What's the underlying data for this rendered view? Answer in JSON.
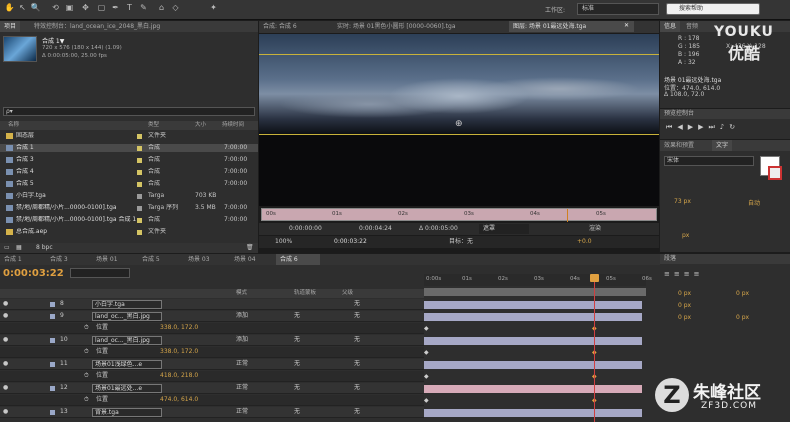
{
  "toolbar": {
    "workspace_label": "工作区:",
    "workspace_value": "标准",
    "search_placeholder": "搜索帮助"
  },
  "watermark": {
    "youku": "YOUKU",
    "youku_cn": "优酷",
    "zf_name": "朱峰社区",
    "zf_url": "ZF3D.COM"
  },
  "project": {
    "tab": "项目",
    "tab2": "特效控制台：land_ocean_ice_2048_黑白.jpg",
    "item_name": "合成 1▼",
    "item_size": "720 x 576 (180 x 144) (1.09)",
    "item_dur": "Δ 0:00:05:00, 25.00 fps",
    "search_placeholder": "ρ▾",
    "col_name": "名称",
    "col_type": "类型",
    "col_size": "大小",
    "col_rate": "持续时间",
    "items": [
      {
        "name": "固态层",
        "type": "文件夹",
        "size": "",
        "dur": "",
        "color": "#d4c464"
      },
      {
        "name": "合成 1",
        "type": "合成",
        "size": "",
        "dur": "7:00:00",
        "color": "#d4c464"
      },
      {
        "name": "合成 3",
        "type": "合成",
        "size": "",
        "dur": "7:00:00",
        "color": "#d4c464"
      },
      {
        "name": "合成 4",
        "type": "合成",
        "size": "",
        "dur": "7:00:00",
        "color": "#d4c464"
      },
      {
        "name": "合成 5",
        "type": "合成",
        "size": "",
        "dur": "7:00:00",
        "color": "#d4c464"
      },
      {
        "name": "小白字.tga",
        "type": "Targa",
        "size": "703 KB",
        "dur": "",
        "color": "#9a9a9a"
      },
      {
        "name": "禁/地/周都精/小片...0000-0100].tga",
        "type": "Targa 序列",
        "size": "3.5 MB",
        "dur": "7:00:00",
        "color": "#9a9a9a"
      },
      {
        "name": "禁/地/周都精/小片...0000-0100].tga 合成 1",
        "type": "合成",
        "size": "",
        "dur": "7:00:00",
        "color": "#d4c464"
      },
      {
        "name": "总合成.aep",
        "type": "文件夹",
        "size": "",
        "dur": "",
        "color": "#d4c464"
      }
    ],
    "bpc": "8 bpc"
  },
  "viewer": {
    "tabs": [
      "合成: 合成 6",
      "实时: 场景 01黑色小圆形 [0000-0060].tga",
      "图层: 场景 01最远处海.tga"
    ],
    "ruler": [
      "00s",
      "01s",
      "02s",
      "03s",
      "04s",
      "05s",
      "06s"
    ],
    "zoom": "100%",
    "t1": "0:00:00:00",
    "t2": "0:00:04:24",
    "t3": "Δ 0:00:05:00",
    "time": "0:00:03:22",
    "view": "目标：无",
    "mode": "遮罩",
    "render": "渲染",
    "plus": "+0.0"
  },
  "info": {
    "tab1": "信息",
    "tab2": "音频",
    "r": "R : 178",
    "g": "G : 185",
    "b": "B : 196",
    "a": "A : 32",
    "xy": "X: 436  Y: 128",
    "file": "场景 01最远处海.tga",
    "pos": "位置：474.0, 614.0",
    "delta": "Δ 108.0, 72.0"
  },
  "preview": {
    "tab": "预览控制台"
  },
  "effects": {
    "tab": "效果和预置",
    "tab2": "文字",
    "font": "宋体",
    "size": "73 px",
    "auto": "自动",
    "px": "px"
  },
  "para": {
    "tab": "段落",
    "v1": "0 px",
    "v2": "0 px",
    "v3": "0 px",
    "v4": "0 px",
    "v5": "0 px"
  },
  "timeline": {
    "tabs": [
      "合成 1",
      "合成 3",
      "场景 01",
      "合成 5",
      "场景 03",
      "场景 04",
      "合成 6"
    ],
    "time": "0:00:03:22",
    "col_mode": "模式",
    "col_trk": "轨道蒙板",
    "col_parent": "父级",
    "ruler": [
      "0:00s",
      "01s",
      "02s",
      "03s",
      "04s",
      "05s",
      "06s"
    ],
    "layers": [
      {
        "num": "8",
        "name": "小白字.tga",
        "mode": "",
        "trk": "",
        "parent": "无",
        "sub": false,
        "pink": false
      },
      {
        "num": "9",
        "name": "land_oc..._黑白.jpg",
        "mode": "添加",
        "trk": "无",
        "parent": "无",
        "sub": false,
        "pink": false
      },
      {
        "num": "",
        "name": "位置",
        "mode": "",
        "trk": "",
        "parent": "",
        "sub": true,
        "val": "338.0, 172.0",
        "pink": false
      },
      {
        "num": "10",
        "name": "land_oc..._黑白.jpg",
        "mode": "添加",
        "trk": "无",
        "parent": "无",
        "sub": false,
        "pink": false
      },
      {
        "num": "",
        "name": "位置",
        "mode": "",
        "trk": "",
        "parent": "",
        "sub": true,
        "val": "338.0, 172.0",
        "pink": false
      },
      {
        "num": "11",
        "name": "场景01浅绿色...e",
        "mode": "正常",
        "trk": "无",
        "parent": "无",
        "sub": false,
        "pink": false
      },
      {
        "num": "",
        "name": "位置",
        "mode": "",
        "trk": "",
        "parent": "",
        "sub": true,
        "val": "418.0, 218.0",
        "pink": false
      },
      {
        "num": "12",
        "name": "场景01最远处...e",
        "mode": "正常",
        "trk": "无",
        "parent": "无",
        "sub": false,
        "pink": true
      },
      {
        "num": "",
        "name": "位置",
        "mode": "",
        "trk": "",
        "parent": "",
        "sub": true,
        "val": "474.0, 614.0",
        "pink": false
      },
      {
        "num": "13",
        "name": "背景.tga",
        "mode": "正常",
        "trk": "无",
        "parent": "无",
        "sub": false,
        "pink": false
      }
    ]
  }
}
